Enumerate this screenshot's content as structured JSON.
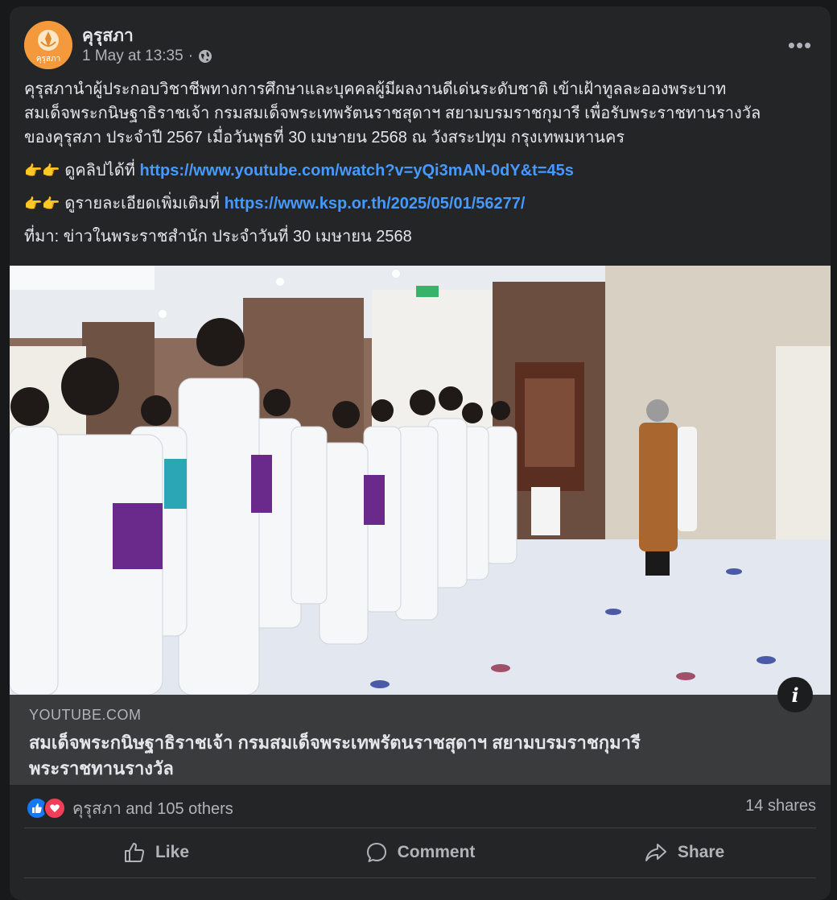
{
  "post": {
    "page_name": "คุรุสภา",
    "avatar_text": "คุรุสภา",
    "timestamp": "1 May at 13:35",
    "dot": "·",
    "more_label": "•••",
    "text": {
      "paragraph_line1": "คุรุสภานำผู้ประกอบวิชาชีพทางการศึกษาและบุคคลผู้มีผลงานดีเด่นระดับชาติ เข้าเฝ้าทูลละอองพระบาท",
      "paragraph_line2": "สมเด็จพระกนิษฐาธิราชเจ้า กรมสมเด็จพระเทพรัตนราชสุดาฯ สยามบรมราชกุมารี เพื่อรับพระราชทานรางวัล",
      "paragraph_line3": "ของคุรุสภา ประจำปี 2567 เมื่อวันพุธที่ 30 เมษายน 2568 ณ วังสระปทุม กรุงเทพมหานคร",
      "clip_emoji": "👉👉",
      "clip_label": "ดูคลิปได้ที่",
      "clip_link": "https://www.youtube.com/watch?v=yQi3mAN-0dY&t=45s",
      "detail_emoji": "👉👉",
      "detail_label": "ดูรายละเอียดเพิ่มเติมที่",
      "detail_link": "https://www.ksp.or.th/2025/05/01/56277/",
      "source": "ที่มา: ข่าวในพระราชสำนัก ประจำวันที่ 30 เมษายน 2568"
    }
  },
  "link_preview": {
    "domain": "YOUTUBE.COM",
    "title_line1": "สมเด็จพระกนิษฐาธิราชเจ้า กรมสมเด็จพระเทพรัตนราชสุดาฯ สยามบรมราชกุมารี",
    "title_line2": "พระราชทานรางวัล",
    "info_label": "i"
  },
  "engagement": {
    "reactions_text": "คุรุสภา and 105 others",
    "shares_text": "14 shares"
  },
  "actions": {
    "like": "Like",
    "comment": "Comment",
    "share": "Share"
  },
  "colors": {
    "background": "#18191a",
    "card": "#242526",
    "link": "#4599ff",
    "like_blue": "#1877f2",
    "love_red": "#f33e58",
    "avatar_orange": "#f59a3c"
  }
}
